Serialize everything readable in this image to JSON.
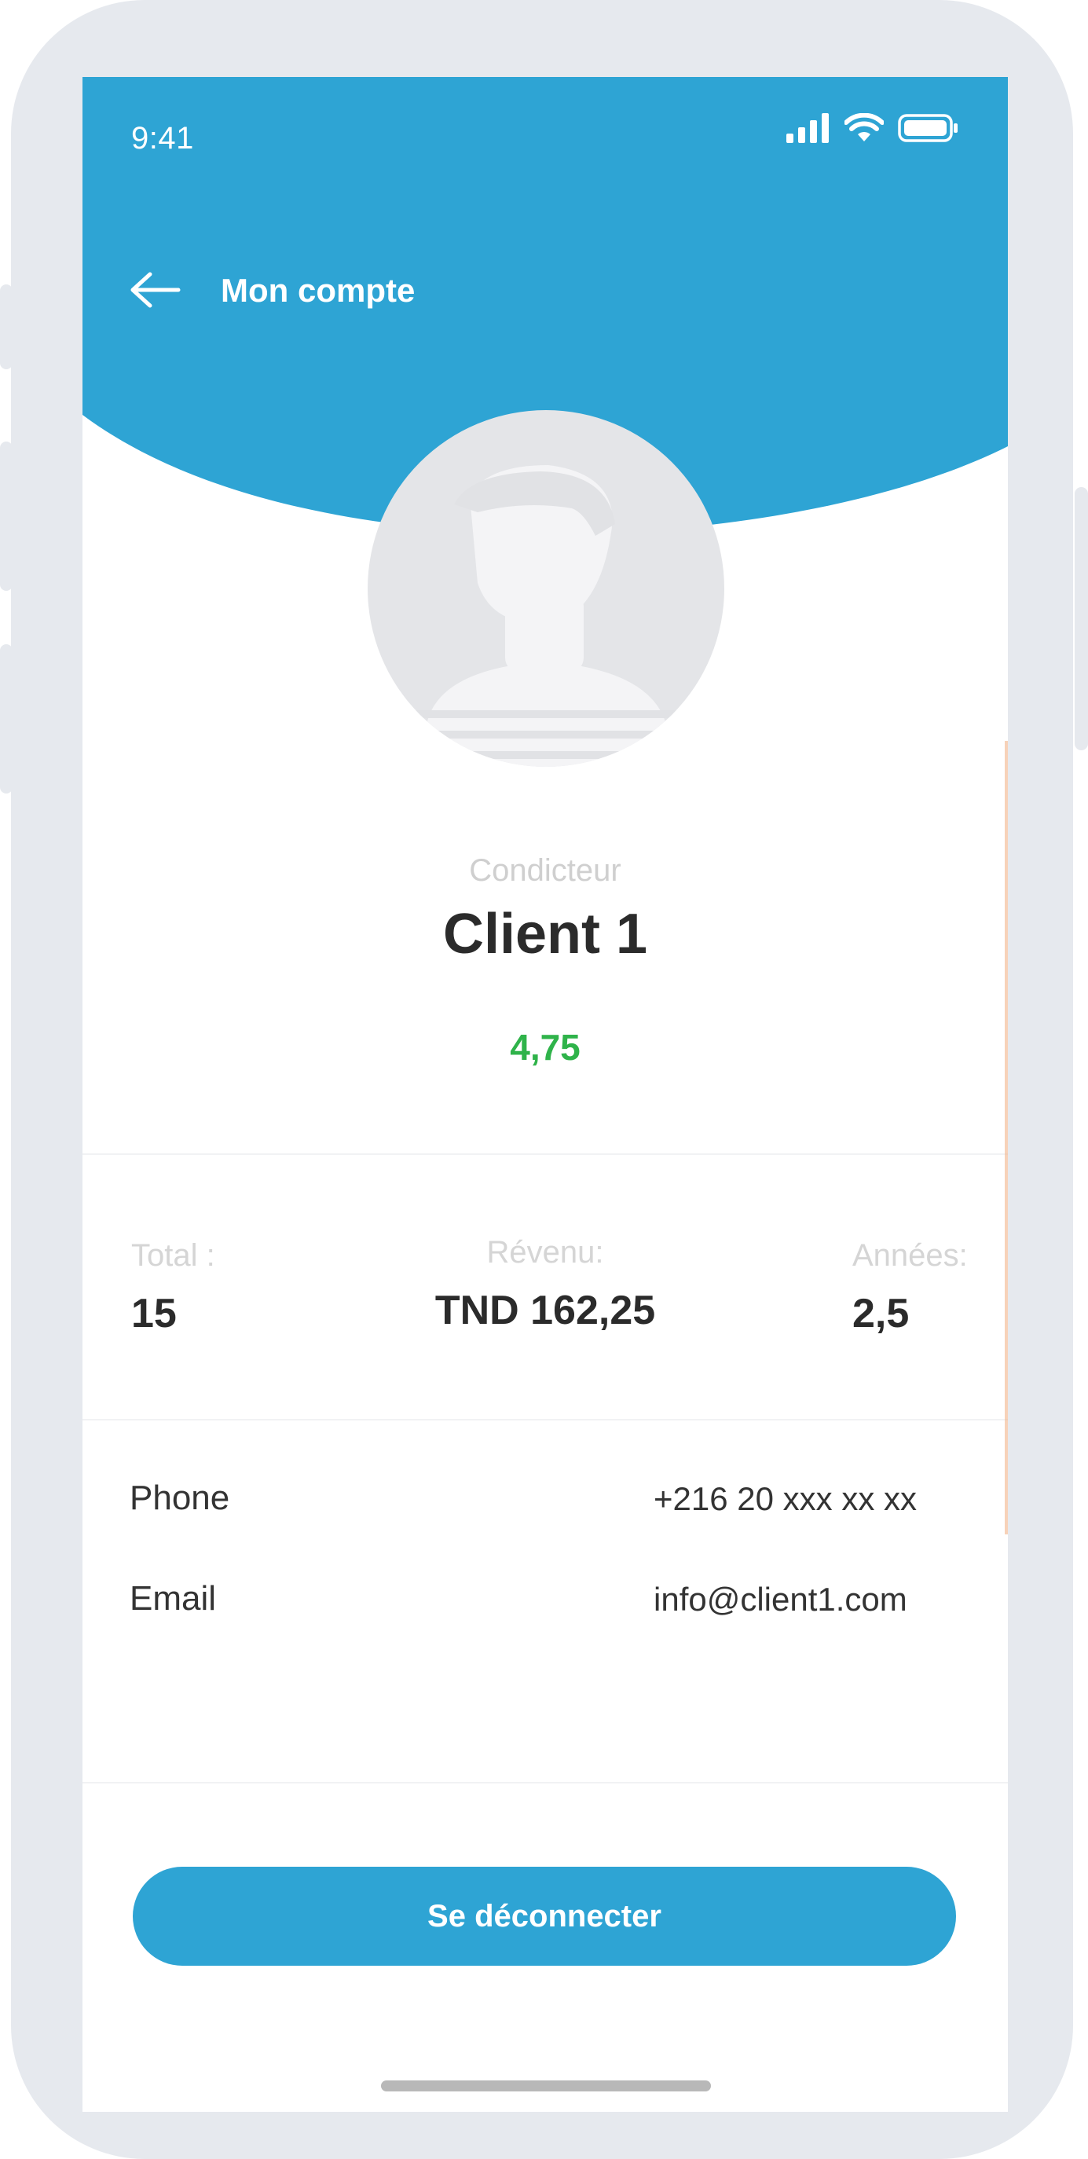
{
  "status_bar": {
    "time": "9:41"
  },
  "header": {
    "title": "Mon compte"
  },
  "profile": {
    "role": "Condicteur",
    "name": "Client 1",
    "rating": "4,75"
  },
  "stats": [
    {
      "label": "Total :",
      "value": "15"
    },
    {
      "label": "Révenu:",
      "value": "TND 162,25"
    },
    {
      "label": "Années:",
      "value": "2,5"
    }
  ],
  "contact": {
    "phone_label": "Phone",
    "phone_value": "+216 20 xxx xx xx",
    "email_label": "Email",
    "email_value": "info@client1.com"
  },
  "actions": {
    "logout_label": "Se déconnecter"
  },
  "colors": {
    "accent": "#2ea4d4",
    "rating": "#2fb34a",
    "frame": "#e6e9ee"
  },
  "icons": [
    "signal-icon",
    "wifi-icon",
    "battery-icon",
    "back-arrow-icon",
    "avatar-placeholder-icon"
  ]
}
